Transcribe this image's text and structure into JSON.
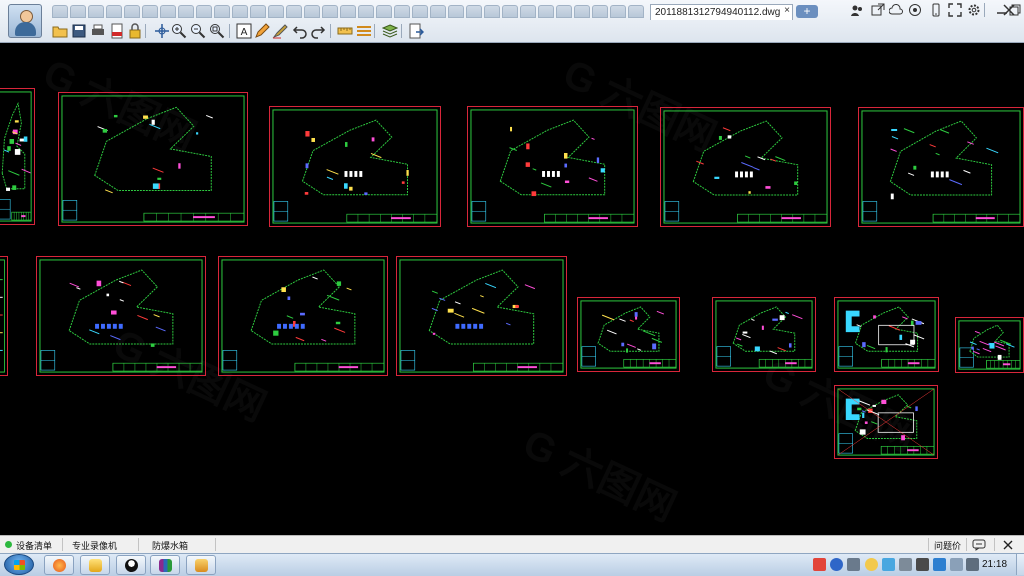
{
  "window": {
    "file_tab": "20118813127949​40112.dwg",
    "file_tab_close": "×",
    "new_tab": "+"
  },
  "toolbar": {
    "icons": [
      "open-icon",
      "save-icon",
      "print-icon",
      "pdf-icon",
      "lock-icon",
      "pan-icon",
      "zoom-in-icon",
      "zoom-out-icon",
      "zoom-window-icon",
      "text-icon",
      "pen-icon",
      "markup-icon",
      "undo-icon",
      "redo-icon",
      "measure-icon",
      "layer-icon",
      "layers-stack-icon",
      "export-icon"
    ]
  },
  "window_controls": {
    "icons": [
      "share-icon",
      "open-external-icon",
      "cloud-icon",
      "collaborate-icon",
      "mobile-icon",
      "fullscreen-icon",
      "settings-icon",
      "minimize-icon",
      "restore-icon",
      "close-icon"
    ]
  },
  "status_bar": {
    "items": [
      "设备清单",
      "专业录像机",
      "防爆水箱"
    ],
    "right_text": "问题价",
    "chat_icon": "chat-icon",
    "close_icon": "close-icon"
  },
  "taskbar": {
    "clock": "21:18",
    "apps": [
      "firefox-icon",
      "favorites-icon",
      "qq-icon",
      "winrar-icon",
      "file-manager-icon"
    ],
    "accent": "#d8263a"
  },
  "colors": {
    "sheet_border": "#d8263a",
    "inner_border": "#2ecc40",
    "canvas_bg": "#000000"
  }
}
